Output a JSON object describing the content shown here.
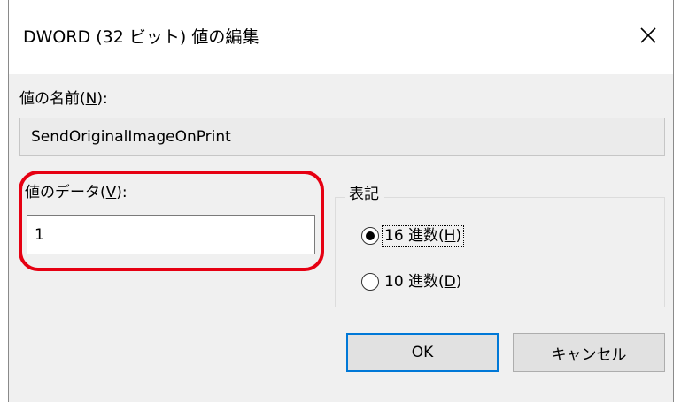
{
  "dialog": {
    "title": "DWORD (32 ビット) 値の編集",
    "close_icon": "close-icon"
  },
  "name_field": {
    "label_prefix": "値の名前(",
    "label_accel": "N",
    "label_suffix": "):",
    "value": "SendOriginalImageOnPrint"
  },
  "data_field": {
    "label_prefix": "値のデータ(",
    "label_accel": "V",
    "label_suffix": "):",
    "value": "1"
  },
  "base_group": {
    "legend": "表記",
    "options": [
      {
        "prefix": "16 進数(",
        "accel": "H",
        "suffix": ")",
        "selected": true
      },
      {
        "prefix": "10 進数(",
        "accel": "D",
        "suffix": ")",
        "selected": false
      }
    ]
  },
  "buttons": {
    "ok_label": "OK",
    "cancel_label": "キャンセル"
  },
  "colors": {
    "highlight": "#e60012",
    "default_button_border": "#0078d7",
    "dialog_background": "#f0f0f0"
  }
}
